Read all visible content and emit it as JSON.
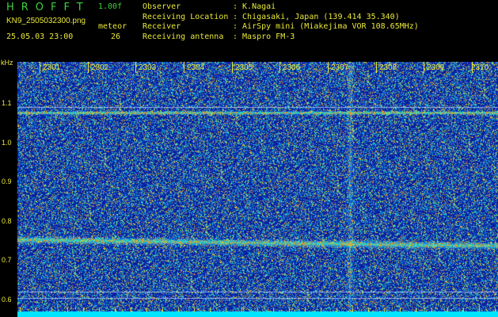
{
  "header": {
    "logo": "HROFFT",
    "version": "1.00f",
    "filename": "KN9_2505032300.png",
    "meteor_label": "meteor",
    "datetime": "25.05.03 23:00",
    "count": "26",
    "info": [
      {
        "key": "Observer",
        "value": ": K.Nagai"
      },
      {
        "key": "Receiving Location",
        "value": ": Chigasaki, Japan (139.414 35.340)"
      },
      {
        "key": "Receiver",
        "value": ": AirSpy mini (Miakejima VOR 108.65MHz)"
      },
      {
        "key": "Receiving antenna",
        "value": ": Maspro FM-3"
      }
    ]
  },
  "axes": {
    "yunit": "kHz",
    "yticks": [
      "1.1",
      "1.0",
      "0.9",
      "0.8",
      "0.7",
      "0.6"
    ],
    "xticks": [
      "2301",
      "2302",
      "2303",
      "2304",
      "2305",
      "2306",
      "2307",
      "2308",
      "2309",
      "2310"
    ]
  },
  "colors": {
    "background": "#0a1f9c",
    "text": "#e8e83a",
    "logo": "#3cd23c",
    "baseline": "#00e5ff"
  }
}
